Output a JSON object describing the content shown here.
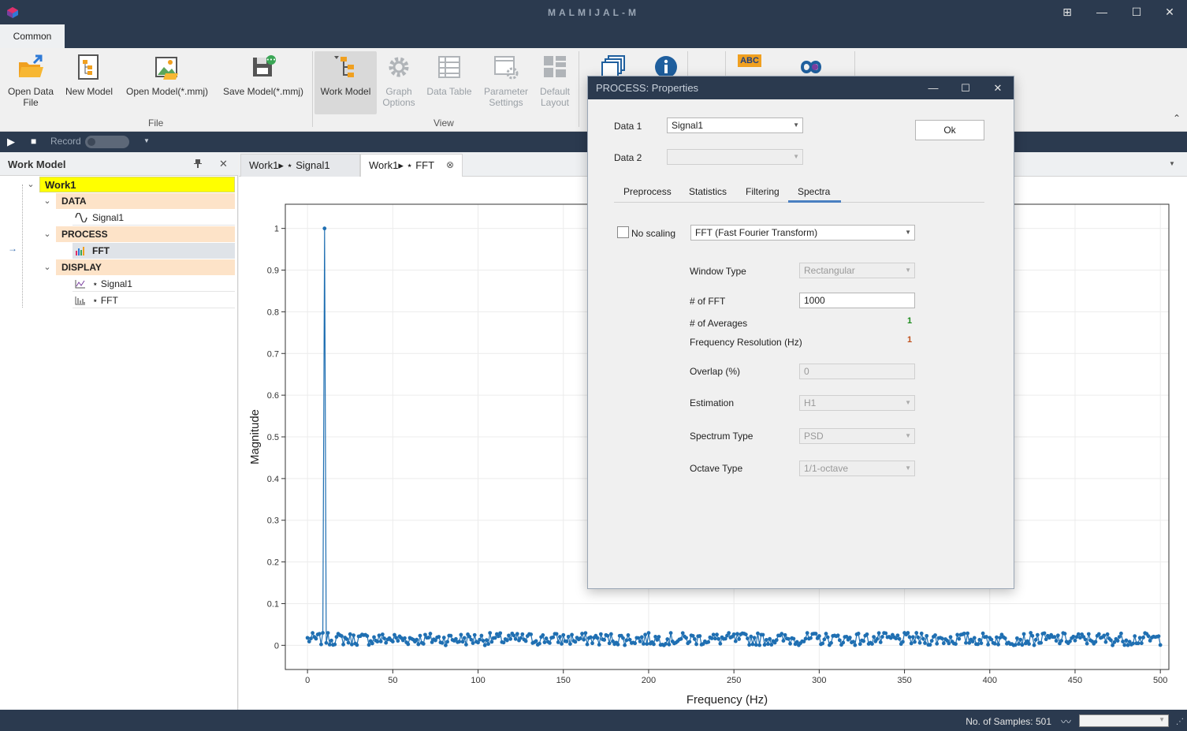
{
  "window": {
    "title": "MALMIJAL-M",
    "restore_icon": "⊞",
    "minimize_icon": "—",
    "maximize_icon": "☐",
    "close_icon": "✕"
  },
  "ribbon": {
    "tab": "Common",
    "groups": {
      "file": "File",
      "view": "View"
    },
    "buttons": {
      "open_data_file_1": "Open Data",
      "open_data_file_2": "File",
      "new_model": "New Model",
      "open_model": "Open Model(*.mmj)",
      "save_model": "Save Model(*.mmj)",
      "work_model": "Work Model",
      "graph_options_1": "Graph",
      "graph_options_2": "Options",
      "data_table": "Data Table",
      "parameter_settings_1": "Parameter",
      "parameter_settings_2": "Settings",
      "default_layout_1": "Default",
      "default_layout_2": "Layout",
      "abc_badge": "ABC"
    },
    "collapse_icon": "⌃"
  },
  "recordbar": {
    "play_icon": "▶",
    "stop_icon": "■",
    "record_label": "Record",
    "dropdown_icon": "▼"
  },
  "leftpanel": {
    "title": "Work Model",
    "pin_icon": "📌",
    "close_icon": "✕",
    "tree": {
      "root": "Work1",
      "data": "DATA",
      "signal1": "Signal1",
      "process": "PROCESS",
      "fft": "FFT",
      "display": "DISPLAY",
      "display_signal1": "⋆ Signal1",
      "display_fft": "⋆ FFT",
      "chevron": "⌄",
      "arrow": "→"
    },
    "colors": {
      "root_bg": "#ffff00",
      "category_bg": "#fde3c8"
    }
  },
  "doctabs": {
    "tab1": "Work1▸ ⋆ Signal1",
    "tab2": "Work1▸ ⋆ FFT",
    "tab2_close": "⊗",
    "dropdown": "▼"
  },
  "chart_data": {
    "type": "scatter",
    "xlabel": "Frequency (Hz)",
    "ylabel": "Magnitude",
    "xlim": [
      -13,
      505
    ],
    "ylim": [
      -0.058,
      1.058
    ],
    "xticks": [
      0,
      50,
      100,
      150,
      200,
      250,
      300,
      350,
      400,
      450,
      500
    ],
    "yticks": [
      0,
      0.1,
      0.2,
      0.3,
      0.4,
      0.5,
      0.6,
      0.7,
      0.8,
      0.9,
      1
    ],
    "series": [
      {
        "x_start": 0,
        "x_end": 500,
        "x_step": 1,
        "peak": {
          "x": 10,
          "y": 1.0
        },
        "noise_level": [
          0.0,
          0.03
        ],
        "color": "#1f6fb2",
        "style": "stem"
      }
    ]
  },
  "dialog": {
    "title": "PROCESS: Properties",
    "minimize_icon": "—",
    "maximize_icon": "☐",
    "close_icon": "✕",
    "data1_label": "Data 1",
    "data1_value": "Signal1",
    "data2_label": "Data 2",
    "data2_value": "",
    "ok_label": "Ok",
    "tabs": [
      "Preprocess",
      "Statistics",
      "Filtering",
      "Spectra"
    ],
    "active_tab": "Spectra",
    "no_scaling_label": "No scaling",
    "transform_value": "FFT (Fast Fourier Transform)",
    "window_type_label": "Window Type",
    "window_type_value": "Rectangular",
    "nfft_label": "# of FFT",
    "nfft_value": "1000",
    "averages_label": "# of Averages",
    "averages_value": "1",
    "freq_res_label": "Frequency Resolution (Hz)",
    "freq_res_value": "1",
    "overlap_label": "Overlap (%)",
    "overlap_value": "0",
    "estimation_label": "Estimation",
    "estimation_value": "H1",
    "spectrum_type_label": "Spectrum Type",
    "spectrum_type_value": "PSD",
    "octave_type_label": "Octave Type",
    "octave_type_value": "1/1-octave",
    "colors": {
      "averages": "#1a8a1a",
      "freq_res": "#c0501a",
      "tab_underline": "#4a7fc1"
    }
  },
  "statusbar": {
    "samples_text": "No. of Samples: 501",
    "waveform_icon": "〰",
    "grip_icon": "⋰"
  }
}
